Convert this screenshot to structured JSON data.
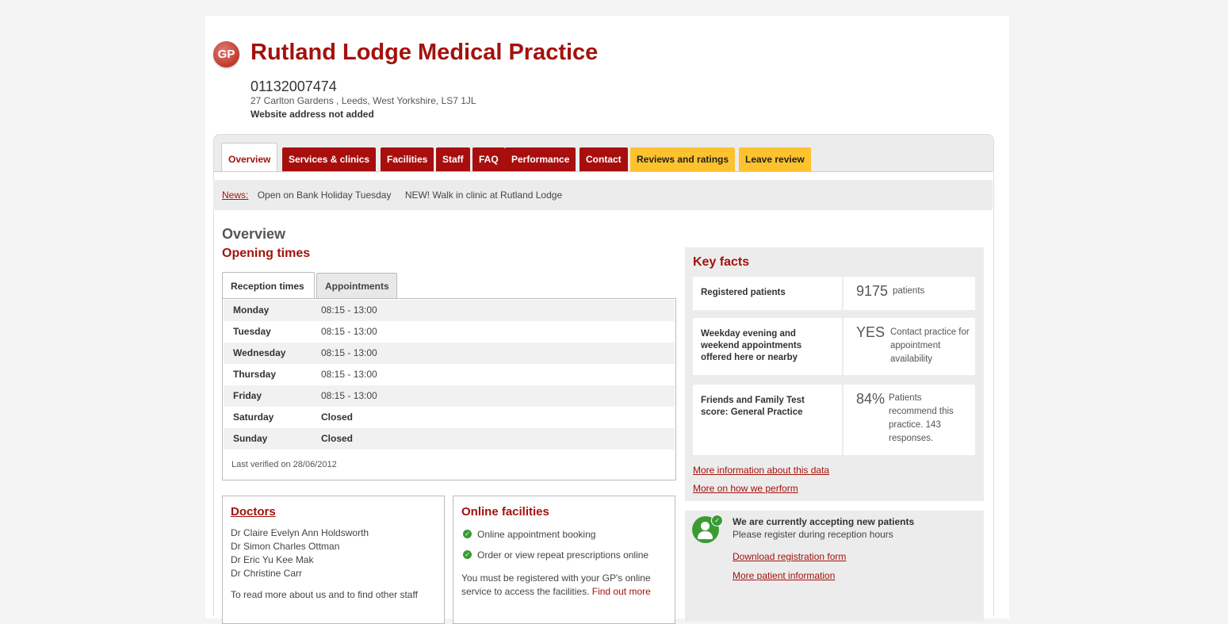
{
  "practice": {
    "logo_text": "GP",
    "name": "Rutland Lodge Medical Practice",
    "phone": "01132007474",
    "address": "27 Carlton Gardens , Leeds, West Yorkshire, LS7 1JL",
    "website": "Website address not added"
  },
  "tabs": [
    {
      "label": "Overview",
      "style": "active"
    },
    {
      "label": "Services & clinics",
      "style": "red"
    },
    {
      "label": "Facilities",
      "style": "red"
    },
    {
      "label": "Staff",
      "style": "red"
    },
    {
      "label": "FAQ",
      "style": "red"
    },
    {
      "label": "Performance",
      "style": "red"
    },
    {
      "label": "Contact",
      "style": "red"
    },
    {
      "label": "Reviews and ratings",
      "style": "yellow"
    },
    {
      "label": "Leave review",
      "style": "yellow"
    }
  ],
  "news": {
    "label": "News:",
    "items": [
      "Open on Bank Holiday Tuesday",
      "NEW! Walk in clinic at Rutland Lodge"
    ]
  },
  "overview": {
    "heading": "Overview",
    "opening_heading": "Opening times",
    "subtabs": [
      "Reception times",
      "Appointments"
    ],
    "times": [
      {
        "day": "Monday",
        "hours": "08:15 - 13:00"
      },
      {
        "day": "Tuesday",
        "hours": "08:15 - 13:00"
      },
      {
        "day": "Wednesday",
        "hours": "08:15 - 13:00"
      },
      {
        "day": "Thursday",
        "hours": "08:15 - 13:00"
      },
      {
        "day": "Friday",
        "hours": "08:15 - 13:00"
      },
      {
        "day": "Saturday",
        "hours": "Closed"
      },
      {
        "day": "Sunday",
        "hours": "Closed"
      }
    ],
    "verified": "Last verified on 28/06/2012"
  },
  "doctors": {
    "heading": "Doctors",
    "names": [
      "Dr Claire Evelyn Ann Holdsworth",
      "Dr Simon Charles Ottman",
      "Dr Eric Yu Kee Mak",
      "Dr Christine Carr"
    ],
    "more_text": "To read more about us and to find other staff"
  },
  "online": {
    "heading": "Online facilities",
    "items": [
      "Online appointment booking",
      "Order or view repeat prescriptions online"
    ],
    "note": "You must be registered with your GP's online service to access the facilities.",
    "note_link": "Find out more"
  },
  "key_facts": {
    "heading": "Key facts",
    "rows": [
      {
        "label": "Registered patients",
        "value": "9175",
        "desc": "patients"
      },
      {
        "label": "Weekday evening and weekend appointments offered here or nearby",
        "value": "YES",
        "desc": "Contact practice for appointment availability"
      },
      {
        "label": "Friends and Family Test score: General Practice",
        "value": "84%",
        "desc": "Patients recommend this practice. 143 responses."
      }
    ],
    "links": [
      "More information about this data",
      "More on how we perform"
    ]
  },
  "accepting": {
    "title": "We are currently accepting new patients",
    "subtitle": "Please register during reception hours",
    "links": [
      "Download registration form",
      "More patient information"
    ]
  }
}
